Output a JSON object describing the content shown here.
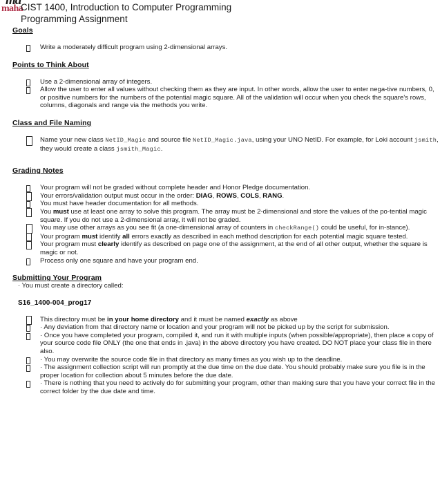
{
  "document": {
    "logo": {
      "top_text": "ma",
      "bottom_text": "maha",
      "accent_color": "#b0314a"
    },
    "title_line_1": "CIST 1400, Introduction to Computer Programming",
    "title_line_2": "Programming Assignment"
  },
  "sections": {
    "goals": {
      "heading": "Goals",
      "items": [
        {
          "text": "Write a moderately difficult program using 2-dimensional arrays."
        }
      ]
    },
    "points": {
      "heading": "Points to Think About",
      "items": [
        {
          "text": "Use a 2-dimensional array of integers."
        },
        {
          "text": "Allow the user to enter all values without checking them as they are input.  In other words, allow the user to enter nega-tive numbers, 0, or positive numbers for the numbers of the potential magic square.  All of the validation will occur when you check the square's rows, columns, diagonals and range via the methods you write."
        }
      ]
    },
    "naming": {
      "heading": "Class and File Naming",
      "item_parts": {
        "p1": "Name your new class ",
        "code1": "NetID_Magic",
        "p2": " and source file ",
        "code2": "NetID_Magic.java",
        "p3": ", using your UNO NetID.  For example, for Loki account ",
        "code3": "jsmith",
        "p4": ", they would create a class ",
        "code4": "jsmith_Magic",
        "p5": "."
      }
    },
    "grading": {
      "heading": "Grading Notes",
      "items": [
        {
          "text": "Your program will not be graded without complete header and Honor Pledge documentation."
        },
        {
          "pre": "Your errors/validation output must occur in the order: ",
          "b1": "DIAG",
          "s1": ", ",
          "b2": "ROWS",
          "s2": ", ",
          "b3": "COLS",
          "s3": ", ",
          "b4": "RANG",
          "post": "."
        },
        {
          "text": "You must have header documentation for all methods."
        },
        {
          "pre": "You ",
          "bold": "must",
          "post": " use at least one array to solve this program.  The array must be 2-dimensional and store the values of the po-tential magic square.  If you do not use a 2-dimensional array, it will not be graded."
        },
        {
          "pre": "You may use other arrays as you see fit (a one-dimensional array of counters in ",
          "code": "checkRange()",
          "post": " could be useful, for in-stance)."
        },
        {
          "pre": "Your program ",
          "b1": "must",
          "mid": " identify ",
          "b2": "all",
          "post": " errors exactly as described in each method description for each potential magic square tested."
        },
        {
          "pre": "Your program must ",
          "bold": "clearly",
          "post": " identify as described on page one of the assignment, at the end of all other output, whether the square is magic or not."
        },
        {
          "text": "Process only one square and have your program end."
        }
      ]
    },
    "submitting": {
      "heading": "Submitting Your Program",
      "lead": "· You must create a directory called:",
      "directory_name": "S16_1400-004_prog17",
      "items": [
        {
          "pre": "This directory must be ",
          "bold": "in your home directory",
          "mid": " and it must be named ",
          "bolditalic": "exactly",
          "post": " as above"
        },
        {
          "text": "· Any deviation from that directory name or location and your program will not be picked up by the script for submission."
        },
        {
          "text": "· Once you have completed your program, compiled it, and run it with multiple inputs (when possible/appropriate), then place a copy of your source code file ONLY (the one that ends in .java) in the above directory you have created. DO NOT place your class file in there also."
        },
        {
          "text": "· You may overwrite the source code file in that directory as many times as you wish up to the deadline."
        },
        {
          "text": "· The assignment collection script will run promptly at the due time on the due date. You should probably make sure you file is in the proper location for collection about 5 minutes before the due date."
        },
        {
          "text": "· There is nothing that you need to actively do for submitting your program, other than making sure that you have your correct file in the correct folder by the due date and time."
        }
      ]
    }
  }
}
